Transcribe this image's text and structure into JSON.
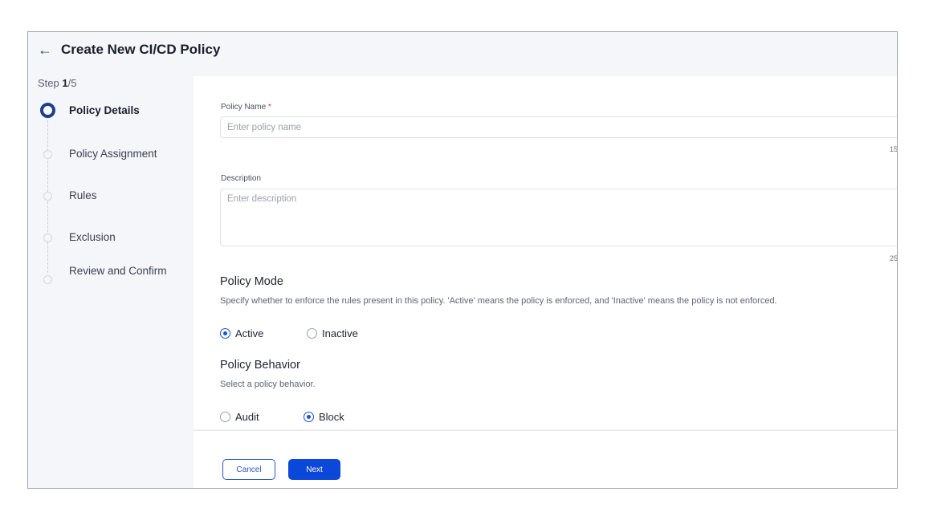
{
  "header": {
    "back_icon": "arrow-left-icon",
    "title": "Create New CI/CD Policy"
  },
  "stepper": {
    "step_prefix": "Step ",
    "current": "1",
    "total_suffix": "/5",
    "steps": [
      {
        "label": "Policy Details",
        "active": true
      },
      {
        "label": "Policy Assignment",
        "active": false
      },
      {
        "label": "Rules",
        "active": false
      },
      {
        "label": "Exclusion",
        "active": false
      },
      {
        "label": "Review and Confirm",
        "active": false
      }
    ]
  },
  "form": {
    "policy_name": {
      "label": "Policy Name ",
      "required_mark": "*",
      "placeholder": "Enter policy name",
      "value": "",
      "counter": "15"
    },
    "description": {
      "label": "Description",
      "placeholder": "Enter description",
      "value": "",
      "counter": "25"
    },
    "policy_mode": {
      "title": "Policy Mode",
      "description": "Specify whether to enforce the rules present in this policy. 'Active' means the policy is enforced, and 'Inactive' means the policy is not enforced.",
      "options": [
        {
          "label": "Active",
          "checked": true
        },
        {
          "label": "Inactive",
          "checked": false
        }
      ]
    },
    "policy_behavior": {
      "title": "Policy Behavior",
      "description": "Select a policy behavior.",
      "options": [
        {
          "label": "Audit",
          "checked": false
        },
        {
          "label": "Block",
          "checked": true
        }
      ]
    }
  },
  "footer": {
    "cancel_label": "Cancel",
    "next_label": "Next"
  },
  "colors": {
    "primary": "#0b47d8",
    "step_active": "#1d3f8f",
    "required": "#c0392b"
  }
}
